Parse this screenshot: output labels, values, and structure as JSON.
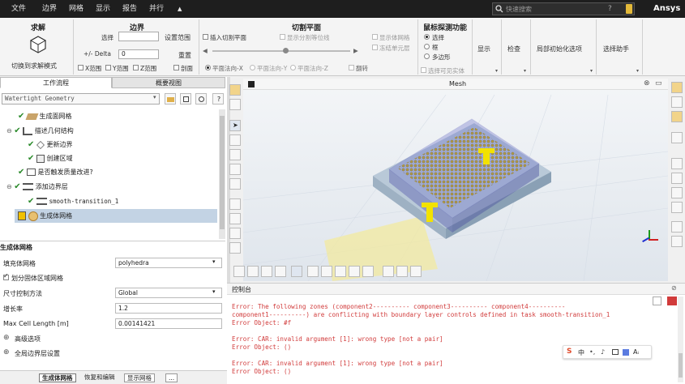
{
  "menubar": {
    "items": [
      "文件",
      "边界",
      "网格",
      "显示",
      "报告",
      "并行"
    ],
    "search_placeholder": "快速搜索",
    "brand": "Ansys"
  },
  "ribbon": {
    "solve": {
      "title": "求解",
      "button": "切换到求解模式"
    },
    "boundary": {
      "title": "边界",
      "select_label": "选择",
      "set_range": "设置范围",
      "delta_label": "+/- Delta",
      "delta_value": "0",
      "reset": "重置",
      "x_range": "X范围",
      "y_range": "Y范围",
      "z_range": "Z范围",
      "section": "剖面"
    },
    "clip": {
      "title": "切割平面",
      "insert": "插入切割平面",
      "show_boundary": "显示分割等位线",
      "show_mesh": "显示体网格",
      "freeze": "冻结单元层",
      "normal_x": "平面法向-X",
      "normal_y": "平面法向-Y",
      "normal_z": "平面法向-Z",
      "flip": "翻转"
    },
    "probe": {
      "title": "鼠标探测功能",
      "opt_select": "选择",
      "opt_box": "框",
      "opt_poly": "多边形",
      "select_visible": "选择可见实体"
    },
    "display": "显示",
    "check": "检查",
    "local_init": "局部初始化选项",
    "select_helper": "选择助手"
  },
  "left": {
    "tab_workflow": "工作流程",
    "tab_outline": "概要视图",
    "workflow_select": "Watertight Geometry",
    "tree": [
      {
        "label": "生成面网格"
      },
      {
        "label": "描述几何结构"
      },
      {
        "label": "更新边界"
      },
      {
        "label": "创建区域"
      },
      {
        "label": "是否触发质量改进?"
      },
      {
        "label": "添加边界层"
      },
      {
        "label": "smooth-transition_1"
      },
      {
        "label": "生成体网格"
      }
    ],
    "props_title": "生成体网格",
    "props": [
      {
        "label": "填充体网格",
        "value": "polyhedra"
      },
      {
        "label": "划分固体区域网格",
        "value": ""
      },
      {
        "label": "尺寸控制方法",
        "value": "Global"
      },
      {
        "label": "增长率",
        "value": "1.2"
      },
      {
        "label": "Max Cell Length [m]",
        "value": "0.00141421"
      },
      {
        "label": "高级选项",
        "value": ""
      },
      {
        "label": "全局边界层设置",
        "value": ""
      }
    ],
    "bottom_buttons": [
      "生成体网格",
      "恢复和编辑",
      "显示网格",
      "..."
    ]
  },
  "viewport": {
    "title": "Mesh"
  },
  "console": {
    "title": "控制台",
    "lines": [
      "Error: The following zones (component2---------- component3---------- component4----------",
      "component1----------) are conflicting with boundary layer controls defined in task smooth-transition_1",
      "Error Object: #f",
      "",
      "Error: CAR: invalid argument [1]: wrong type [not a pair]",
      "Error Object: ()",
      "",
      "Error: CAR: invalid argument [1]: wrong type [not a pair]",
      "Error Object: ()"
    ],
    "ime": [
      "中",
      "Aᵢ"
    ]
  },
  "colors": {
    "accent": "#f0b400",
    "mesh_blue": "#6a6fc8",
    "error": "#d13b3b",
    "menubar": "#1e1e1e"
  }
}
